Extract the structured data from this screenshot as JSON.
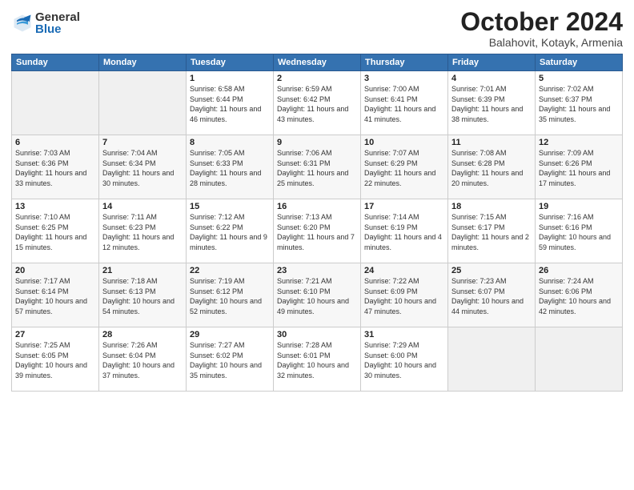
{
  "logo": {
    "general": "General",
    "blue": "Blue"
  },
  "header": {
    "month": "October 2024",
    "location": "Balahovit, Kotayk, Armenia"
  },
  "weekdays": [
    "Sunday",
    "Monday",
    "Tuesday",
    "Wednesday",
    "Thursday",
    "Friday",
    "Saturday"
  ],
  "weeks": [
    [
      {
        "day": "",
        "sunrise": "",
        "sunset": "",
        "daylight": ""
      },
      {
        "day": "",
        "sunrise": "",
        "sunset": "",
        "daylight": ""
      },
      {
        "day": "1",
        "sunrise": "Sunrise: 6:58 AM",
        "sunset": "Sunset: 6:44 PM",
        "daylight": "Daylight: 11 hours and 46 minutes."
      },
      {
        "day": "2",
        "sunrise": "Sunrise: 6:59 AM",
        "sunset": "Sunset: 6:42 PM",
        "daylight": "Daylight: 11 hours and 43 minutes."
      },
      {
        "day": "3",
        "sunrise": "Sunrise: 7:00 AM",
        "sunset": "Sunset: 6:41 PM",
        "daylight": "Daylight: 11 hours and 41 minutes."
      },
      {
        "day": "4",
        "sunrise": "Sunrise: 7:01 AM",
        "sunset": "Sunset: 6:39 PM",
        "daylight": "Daylight: 11 hours and 38 minutes."
      },
      {
        "day": "5",
        "sunrise": "Sunrise: 7:02 AM",
        "sunset": "Sunset: 6:37 PM",
        "daylight": "Daylight: 11 hours and 35 minutes."
      }
    ],
    [
      {
        "day": "6",
        "sunrise": "Sunrise: 7:03 AM",
        "sunset": "Sunset: 6:36 PM",
        "daylight": "Daylight: 11 hours and 33 minutes."
      },
      {
        "day": "7",
        "sunrise": "Sunrise: 7:04 AM",
        "sunset": "Sunset: 6:34 PM",
        "daylight": "Daylight: 11 hours and 30 minutes."
      },
      {
        "day": "8",
        "sunrise": "Sunrise: 7:05 AM",
        "sunset": "Sunset: 6:33 PM",
        "daylight": "Daylight: 11 hours and 28 minutes."
      },
      {
        "day": "9",
        "sunrise": "Sunrise: 7:06 AM",
        "sunset": "Sunset: 6:31 PM",
        "daylight": "Daylight: 11 hours and 25 minutes."
      },
      {
        "day": "10",
        "sunrise": "Sunrise: 7:07 AM",
        "sunset": "Sunset: 6:29 PM",
        "daylight": "Daylight: 11 hours and 22 minutes."
      },
      {
        "day": "11",
        "sunrise": "Sunrise: 7:08 AM",
        "sunset": "Sunset: 6:28 PM",
        "daylight": "Daylight: 11 hours and 20 minutes."
      },
      {
        "day": "12",
        "sunrise": "Sunrise: 7:09 AM",
        "sunset": "Sunset: 6:26 PM",
        "daylight": "Daylight: 11 hours and 17 minutes."
      }
    ],
    [
      {
        "day": "13",
        "sunrise": "Sunrise: 7:10 AM",
        "sunset": "Sunset: 6:25 PM",
        "daylight": "Daylight: 11 hours and 15 minutes."
      },
      {
        "day": "14",
        "sunrise": "Sunrise: 7:11 AM",
        "sunset": "Sunset: 6:23 PM",
        "daylight": "Daylight: 11 hours and 12 minutes."
      },
      {
        "day": "15",
        "sunrise": "Sunrise: 7:12 AM",
        "sunset": "Sunset: 6:22 PM",
        "daylight": "Daylight: 11 hours and 9 minutes."
      },
      {
        "day": "16",
        "sunrise": "Sunrise: 7:13 AM",
        "sunset": "Sunset: 6:20 PM",
        "daylight": "Daylight: 11 hours and 7 minutes."
      },
      {
        "day": "17",
        "sunrise": "Sunrise: 7:14 AM",
        "sunset": "Sunset: 6:19 PM",
        "daylight": "Daylight: 11 hours and 4 minutes."
      },
      {
        "day": "18",
        "sunrise": "Sunrise: 7:15 AM",
        "sunset": "Sunset: 6:17 PM",
        "daylight": "Daylight: 11 hours and 2 minutes."
      },
      {
        "day": "19",
        "sunrise": "Sunrise: 7:16 AM",
        "sunset": "Sunset: 6:16 PM",
        "daylight": "Daylight: 10 hours and 59 minutes."
      }
    ],
    [
      {
        "day": "20",
        "sunrise": "Sunrise: 7:17 AM",
        "sunset": "Sunset: 6:14 PM",
        "daylight": "Daylight: 10 hours and 57 minutes."
      },
      {
        "day": "21",
        "sunrise": "Sunrise: 7:18 AM",
        "sunset": "Sunset: 6:13 PM",
        "daylight": "Daylight: 10 hours and 54 minutes."
      },
      {
        "day": "22",
        "sunrise": "Sunrise: 7:19 AM",
        "sunset": "Sunset: 6:12 PM",
        "daylight": "Daylight: 10 hours and 52 minutes."
      },
      {
        "day": "23",
        "sunrise": "Sunrise: 7:21 AM",
        "sunset": "Sunset: 6:10 PM",
        "daylight": "Daylight: 10 hours and 49 minutes."
      },
      {
        "day": "24",
        "sunrise": "Sunrise: 7:22 AM",
        "sunset": "Sunset: 6:09 PM",
        "daylight": "Daylight: 10 hours and 47 minutes."
      },
      {
        "day": "25",
        "sunrise": "Sunrise: 7:23 AM",
        "sunset": "Sunset: 6:07 PM",
        "daylight": "Daylight: 10 hours and 44 minutes."
      },
      {
        "day": "26",
        "sunrise": "Sunrise: 7:24 AM",
        "sunset": "Sunset: 6:06 PM",
        "daylight": "Daylight: 10 hours and 42 minutes."
      }
    ],
    [
      {
        "day": "27",
        "sunrise": "Sunrise: 7:25 AM",
        "sunset": "Sunset: 6:05 PM",
        "daylight": "Daylight: 10 hours and 39 minutes."
      },
      {
        "day": "28",
        "sunrise": "Sunrise: 7:26 AM",
        "sunset": "Sunset: 6:04 PM",
        "daylight": "Daylight: 10 hours and 37 minutes."
      },
      {
        "day": "29",
        "sunrise": "Sunrise: 7:27 AM",
        "sunset": "Sunset: 6:02 PM",
        "daylight": "Daylight: 10 hours and 35 minutes."
      },
      {
        "day": "30",
        "sunrise": "Sunrise: 7:28 AM",
        "sunset": "Sunset: 6:01 PM",
        "daylight": "Daylight: 10 hours and 32 minutes."
      },
      {
        "day": "31",
        "sunrise": "Sunrise: 7:29 AM",
        "sunset": "Sunset: 6:00 PM",
        "daylight": "Daylight: 10 hours and 30 minutes."
      },
      {
        "day": "",
        "sunrise": "",
        "sunset": "",
        "daylight": ""
      },
      {
        "day": "",
        "sunrise": "",
        "sunset": "",
        "daylight": ""
      }
    ]
  ]
}
